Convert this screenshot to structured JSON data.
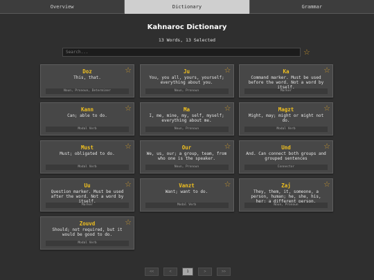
{
  "tabs": [
    {
      "label": "Overview"
    },
    {
      "label": "Dictionary"
    },
    {
      "label": "Grammar"
    }
  ],
  "title": "Kahnaroc Dictionary",
  "subtitle": "13 Words, 13 Selected",
  "search": {
    "placeholder": "Search..."
  },
  "accent_color": "#c8962e",
  "word_color": "#f0c020",
  "words": [
    {
      "word": "Doz",
      "definition": "This, that.",
      "pos": "Noun, Pronoun, Determiner"
    },
    {
      "word": "Ju",
      "definition": "You, you all, yours, yourself; everything about you.",
      "pos": "Noun, Pronoun"
    },
    {
      "word": "Ka",
      "definition": "Command marker. Must be used before the word. Not a word by itself.",
      "pos": "Marker"
    },
    {
      "word": "Kann",
      "definition": "Can; able to do.",
      "pos": "Modal Verb"
    },
    {
      "word": "Ma",
      "definition": "I, me, mine, my, self, myself; everything about me.",
      "pos": "Noun, Pronoun"
    },
    {
      "word": "Magzt",
      "definition": "Might, may; might or might not do.",
      "pos": "Modal Verb"
    },
    {
      "word": "Must",
      "definition": "Must; obligated to do.",
      "pos": "Modal Verb"
    },
    {
      "word": "Our",
      "definition": "We, us, our; a group, team, from who one is the speaker.",
      "pos": "Noun, Pronoun"
    },
    {
      "word": "Und",
      "definition": "And. Can connect both groups and grouped sentences",
      "pos": "Connector"
    },
    {
      "word": "Uu",
      "definition": "Question marker. Must be used after the word. Not a word by itself.",
      "pos": "Marker"
    },
    {
      "word": "Vanzt",
      "definition": "Want; want to do.",
      "pos": "Modal Verb"
    },
    {
      "word": "Zaj",
      "definition": "They, them, it, someone, a person, human; he, she, his, her; a different person.",
      "pos": "Noun, Pronoun"
    },
    {
      "word": "Zouvd",
      "definition": "Should; not required, but it would be good to do.",
      "pos": "Modal Verb"
    }
  ],
  "pagination": {
    "first": "<<",
    "prev": "<",
    "current": "1",
    "next": ">",
    "last": ">>"
  }
}
